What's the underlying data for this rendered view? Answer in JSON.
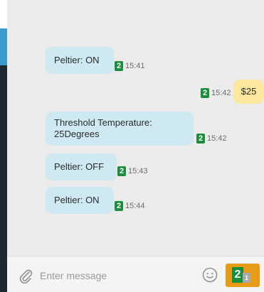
{
  "messages": [
    {
      "direction": "in",
      "text": "Peltier: ON",
      "badge": "2",
      "time": "15:41"
    },
    {
      "direction": "out",
      "text": "$25",
      "badge": "2",
      "time": "15:42"
    },
    {
      "direction": "in",
      "text": "Threshold Temperature: 25Degrees",
      "badge": "2",
      "time": "15:42"
    },
    {
      "direction": "in",
      "text": "Peltier: OFF",
      "badge": "2",
      "time": "15:43"
    },
    {
      "direction": "in",
      "text": "Peltier: ON",
      "badge": "2",
      "time": "15:44"
    }
  ],
  "composer": {
    "placeholder": "Enter message",
    "attach_icon": "paperclip-icon",
    "emoji_icon": "smiley-icon",
    "send_badge_main": "2",
    "send_badge_sub": "1"
  },
  "colors": {
    "incoming_bubble": "#cfe9f2",
    "outgoing_bubble": "#fbe79d",
    "badge_green": "#1a8e3c",
    "send_orange": "#e89b16"
  }
}
